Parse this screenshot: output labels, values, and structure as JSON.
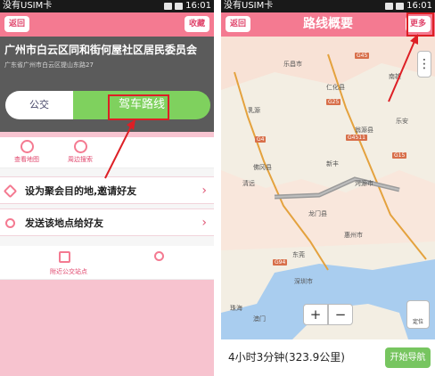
{
  "left": {
    "status": {
      "carrier": "没有USIM卡",
      "time": "16:01"
    },
    "title": {
      "back": "返回",
      "collapse": "收藏"
    },
    "place": {
      "name": "广州市白云区同和街何屋社区居民委员会",
      "address": "广东省广州市白云区提山东路27"
    },
    "route_modes": {
      "transit": "公交",
      "drive": "驾车路线"
    },
    "tools": [
      {
        "label": "查看地图",
        "icon": "map-pin-icon"
      },
      {
        "label": "周边搜索",
        "icon": "radar-icon"
      }
    ],
    "list": [
      {
        "label": "设为聚会目的地,邀请好友",
        "icon": "diamond-icon"
      },
      {
        "label": "发送该地点给好友",
        "icon": "share-icon"
      }
    ],
    "nearby": {
      "label": "附近公交站点"
    }
  },
  "right": {
    "status": {
      "carrier": "没有USIM卡",
      "time": "16:01"
    },
    "title": {
      "back": "返回",
      "heading": "路线概要",
      "more": "更多"
    },
    "map_labels": [
      "乐昌市",
      "仁化县",
      "南雄",
      "乳源",
      "翁源县",
      "新丰",
      "清远",
      "佛冈县",
      "河源市",
      "龙门县",
      "惠州市",
      "东莞",
      "深圳市",
      "澳门",
      "珠海",
      "乐安"
    ],
    "road_badges": [
      "G45",
      "G4",
      "G15",
      "G4511",
      "G94",
      "G25"
    ],
    "controls": {
      "zoom_in": "+",
      "zoom_out": "−",
      "locate": "定位"
    },
    "summary": {
      "duration": "4小时3分钟(323.9公里)",
      "navigate": "开始导航"
    }
  },
  "colors": {
    "pink": "#f47a91",
    "green": "#7fd15e",
    "red_highlight": "#dd1f25"
  }
}
